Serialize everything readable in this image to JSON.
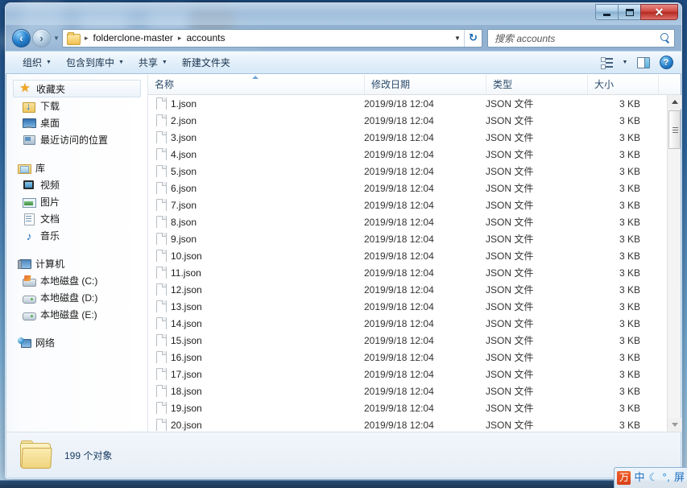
{
  "window": {
    "title": "",
    "controls": {
      "minimize": "–",
      "maximize": "□",
      "close": "✕"
    }
  },
  "navbar": {
    "back_label": "◀",
    "forward_label": "▶",
    "recent_label": "▼",
    "breadcrumb": [
      "folderclone-master",
      "accounts"
    ],
    "breadcrumb_separator": "▸",
    "dropdown_label": "▼",
    "refresh_label": "↻",
    "search_placeholder": "搜索 accounts"
  },
  "toolbar": {
    "items": [
      {
        "label": "组织",
        "caret": true
      },
      {
        "label": "包含到库中",
        "caret": true
      },
      {
        "label": "共享",
        "caret": true
      },
      {
        "label": "新建文件夹",
        "caret": false
      }
    ],
    "views_caret": "▼",
    "help_label": "?"
  },
  "sidebar": {
    "groups": [
      {
        "header": {
          "label": "收藏夹",
          "icon": "star-icon",
          "selected": true
        },
        "items": [
          {
            "label": "下载",
            "icon": "download-icon"
          },
          {
            "label": "桌面",
            "icon": "desktop-icon"
          },
          {
            "label": "最近访问的位置",
            "icon": "recent-places-icon"
          }
        ]
      },
      {
        "header": {
          "label": "库",
          "icon": "library-icon",
          "selected": false
        },
        "items": [
          {
            "label": "视频",
            "icon": "video-icon"
          },
          {
            "label": "图片",
            "icon": "picture-icon"
          },
          {
            "label": "文档",
            "icon": "document-icon"
          },
          {
            "label": "音乐",
            "icon": "music-icon"
          }
        ]
      },
      {
        "header": {
          "label": "计算机",
          "icon": "computer-icon",
          "selected": false
        },
        "items": [
          {
            "label": "本地磁盘 (C:)",
            "icon": "drive-system-icon"
          },
          {
            "label": "本地磁盘 (D:)",
            "icon": "drive-icon"
          },
          {
            "label": "本地磁盘 (E:)",
            "icon": "drive-icon"
          }
        ]
      },
      {
        "header": {
          "label": "网络",
          "icon": "network-icon",
          "selected": false
        },
        "items": []
      }
    ]
  },
  "filelist": {
    "columns": [
      "名称",
      "修改日期",
      "类型",
      "大小"
    ],
    "sorted_by": "名称",
    "sort_direction": "asc",
    "rows": [
      {
        "name": "1.json",
        "date": "2019/9/18 12:04",
        "type": "JSON 文件",
        "size": "3 KB"
      },
      {
        "name": "2.json",
        "date": "2019/9/18 12:04",
        "type": "JSON 文件",
        "size": "3 KB"
      },
      {
        "name": "3.json",
        "date": "2019/9/18 12:04",
        "type": "JSON 文件",
        "size": "3 KB"
      },
      {
        "name": "4.json",
        "date": "2019/9/18 12:04",
        "type": "JSON 文件",
        "size": "3 KB"
      },
      {
        "name": "5.json",
        "date": "2019/9/18 12:04",
        "type": "JSON 文件",
        "size": "3 KB"
      },
      {
        "name": "6.json",
        "date": "2019/9/18 12:04",
        "type": "JSON 文件",
        "size": "3 KB"
      },
      {
        "name": "7.json",
        "date": "2019/9/18 12:04",
        "type": "JSON 文件",
        "size": "3 KB"
      },
      {
        "name": "8.json",
        "date": "2019/9/18 12:04",
        "type": "JSON 文件",
        "size": "3 KB"
      },
      {
        "name": "9.json",
        "date": "2019/9/18 12:04",
        "type": "JSON 文件",
        "size": "3 KB"
      },
      {
        "name": "10.json",
        "date": "2019/9/18 12:04",
        "type": "JSON 文件",
        "size": "3 KB"
      },
      {
        "name": "11.json",
        "date": "2019/9/18 12:04",
        "type": "JSON 文件",
        "size": "3 KB"
      },
      {
        "name": "12.json",
        "date": "2019/9/18 12:04",
        "type": "JSON 文件",
        "size": "3 KB"
      },
      {
        "name": "13.json",
        "date": "2019/9/18 12:04",
        "type": "JSON 文件",
        "size": "3 KB"
      },
      {
        "name": "14.json",
        "date": "2019/9/18 12:04",
        "type": "JSON 文件",
        "size": "3 KB"
      },
      {
        "name": "15.json",
        "date": "2019/9/18 12:04",
        "type": "JSON 文件",
        "size": "3 KB"
      },
      {
        "name": "16.json",
        "date": "2019/9/18 12:04",
        "type": "JSON 文件",
        "size": "3 KB"
      },
      {
        "name": "17.json",
        "date": "2019/9/18 12:04",
        "type": "JSON 文件",
        "size": "3 KB"
      },
      {
        "name": "18.json",
        "date": "2019/9/18 12:04",
        "type": "JSON 文件",
        "size": "3 KB"
      },
      {
        "name": "19.json",
        "date": "2019/9/18 12:04",
        "type": "JSON 文件",
        "size": "3 KB"
      },
      {
        "name": "20.json",
        "date": "2019/9/18 12:04",
        "type": "JSON 文件",
        "size": "3 KB"
      }
    ]
  },
  "statusbar": {
    "text": "199 个对象"
  },
  "tray": {
    "items": [
      {
        "icon": "ime-logo-icon",
        "label": "万"
      },
      {
        "icon": "ime-chinese-icon",
        "label": "中"
      },
      {
        "icon": "ime-moon-icon",
        "label": "☾"
      },
      {
        "icon": "ime-degree-icon",
        "label": "°,"
      },
      {
        "icon": "ime-more-icon",
        "label": "屏"
      }
    ]
  },
  "colors": {
    "accent": "#1b6fc0",
    "title_close": "#cf4a42",
    "folder_yellow": "#f0d47e",
    "desktop_blue": "#2f6ba8"
  }
}
